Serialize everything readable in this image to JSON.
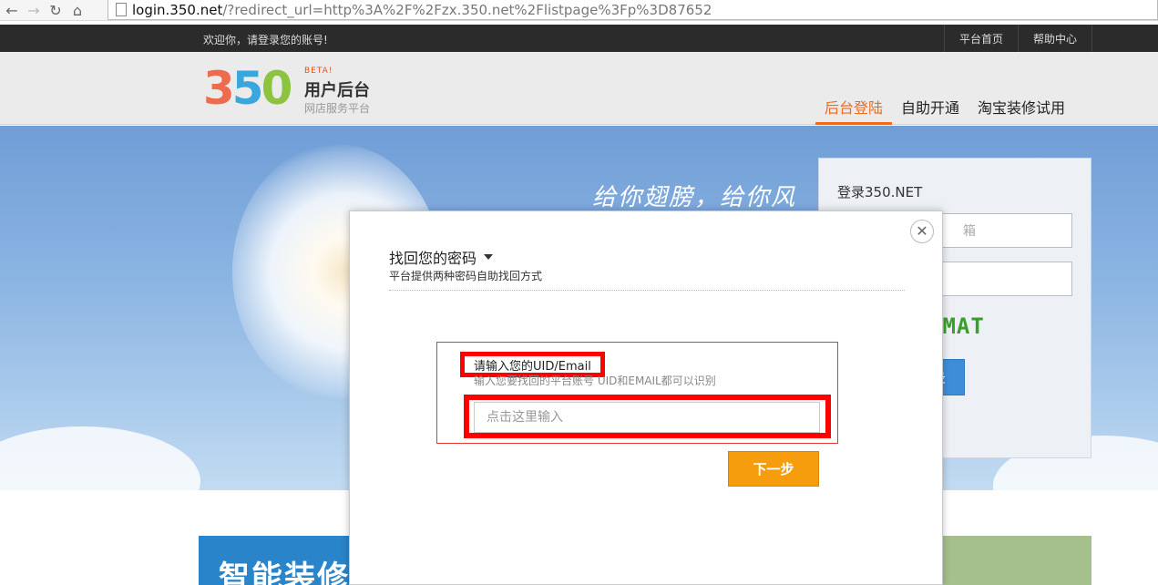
{
  "browser": {
    "url_host": "login.350.net",
    "url_path": "/?redirect_url=http%3A%2F%2Fzx.350.net%2Flistpage%3Fp%3D87652"
  },
  "topbar": {
    "welcome": "欢迎你，请登录您的账号!",
    "links": [
      "平台首页",
      "帮助中心"
    ]
  },
  "logo": {
    "digits": [
      "3",
      "5",
      "0"
    ],
    "beta": "BETA!",
    "title": "用户后台",
    "subtitle": "网店服务平台"
  },
  "nav": {
    "items": [
      "后台登陆",
      "自助开通",
      "淘宝装修试用"
    ],
    "active_index": 0
  },
  "banner": {
    "slogan": "给你翅膀，给你风"
  },
  "login_panel": {
    "title": "登录350.NET",
    "email_fragment": "箱",
    "captcha": "CMAT",
    "login_button_fragment": "录"
  },
  "tiles": [
    "智能装修",
    "",
    ""
  ],
  "modal": {
    "title": "找回您的密码",
    "subtitle": "平台提供两种密码自助找回方式",
    "field_label": "请输入您的UID/Email",
    "field_hint": "输入您要找回的平台账号 UID和EMAIL都可以识别",
    "input_placeholder": "点击这里输入",
    "next_button": "下一步",
    "close_symbol": "✕"
  },
  "colors": {
    "accent_orange": "#ef6a1a",
    "button_orange": "#f59d0c",
    "highlight_red": "#ff0000"
  }
}
